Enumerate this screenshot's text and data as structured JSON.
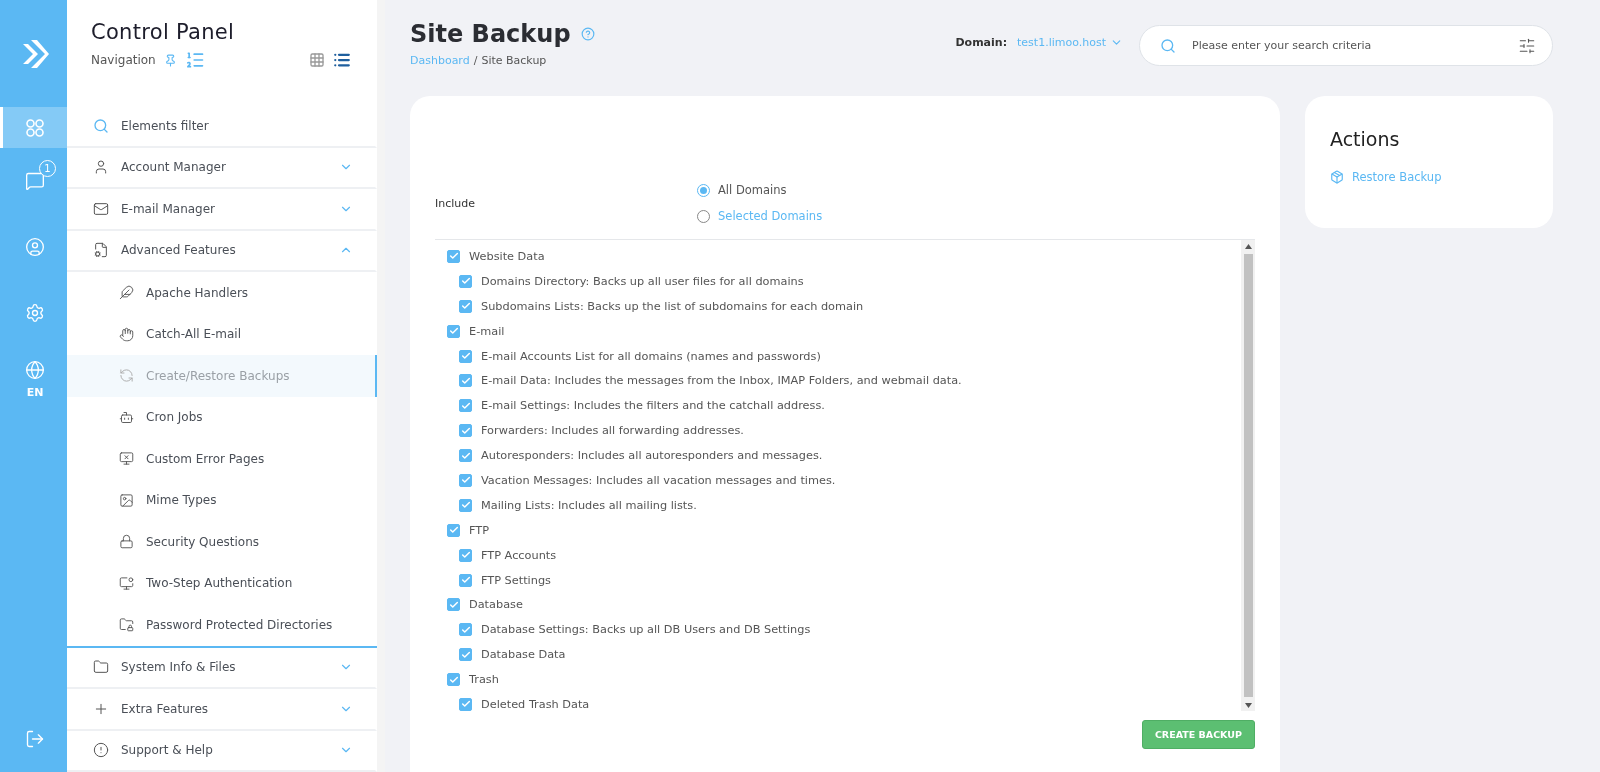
{
  "rail": {
    "language": "EN",
    "badge": "1",
    "items": [
      {
        "selected": false
      },
      {
        "selected": true
      },
      {
        "selected": false
      },
      {
        "selected": false
      },
      {
        "selected": false
      },
      {
        "selected": false
      }
    ]
  },
  "sidebar": {
    "title": "Control Panel",
    "subtitle": "Navigation",
    "filter": {
      "placeholder": "Elements filter"
    },
    "sections": [
      {
        "label": "Account Manager",
        "expanded": false
      },
      {
        "label": "E-mail Manager",
        "expanded": false
      },
      {
        "label": "Advanced Features",
        "expanded": true,
        "children": [
          {
            "label": "Apache Handlers",
            "selected": false
          },
          {
            "label": "Catch-All E-mail",
            "selected": false
          },
          {
            "label": "Create/Restore Backups",
            "selected": true
          },
          {
            "label": "Cron Jobs",
            "selected": false
          },
          {
            "label": "Custom Error Pages",
            "selected": false
          },
          {
            "label": "Mime Types",
            "selected": false
          },
          {
            "label": "Security Questions",
            "selected": false
          },
          {
            "label": "Two-Step Authentication",
            "selected": false
          },
          {
            "label": "Password Protected Directories",
            "selected": false
          }
        ]
      },
      {
        "label": "System Info & Files",
        "expanded": false
      },
      {
        "label": "Extra Features",
        "expanded": false
      },
      {
        "label": "Support & Help",
        "expanded": false
      }
    ]
  },
  "header": {
    "title": "Site Backup",
    "breadcrumb_separator": "/",
    "breadcrumb": [
      {
        "label": "Dashboard",
        "kind": "link"
      },
      {
        "label": "Site Backup",
        "kind": "current"
      }
    ],
    "domain_label": "Domain:",
    "domain": "test1.limoo.host",
    "search": {
      "placeholder": "Please enter your search criteria"
    }
  },
  "backup": {
    "include_label": "Include",
    "scope": [
      {
        "label": "All Domains",
        "selected": true
      },
      {
        "label": "Selected Domains",
        "selected": false
      }
    ],
    "groups": [
      {
        "label": "Website Data",
        "checked": true,
        "children": [
          {
            "label": "Domains Directory: Backs up all user files for all domains",
            "checked": true
          },
          {
            "label": "Subdomains Lists: Backs up the list of subdomains for each domain",
            "checked": true
          }
        ]
      },
      {
        "label": "E-mail",
        "checked": true,
        "children": [
          {
            "label": "E-mail Accounts List for all domains (names and passwords)",
            "checked": true
          },
          {
            "label": "E-mail Data: Includes the messages from the Inbox, IMAP Folders, and webmail data.",
            "checked": true
          },
          {
            "label": "E-mail Settings: Includes the filters and the catchall address.",
            "checked": true
          },
          {
            "label": "Forwarders: Includes all forwarding addresses.",
            "checked": true
          },
          {
            "label": "Autoresponders: Includes all autoresponders and messages.",
            "checked": true
          },
          {
            "label": "Vacation Messages: Includes all vacation messages and times.",
            "checked": true
          },
          {
            "label": "Mailing Lists: Includes all mailing lists.",
            "checked": true
          }
        ]
      },
      {
        "label": "FTP",
        "checked": true,
        "children": [
          {
            "label": "FTP Accounts",
            "checked": true
          },
          {
            "label": "FTP Settings",
            "checked": true
          }
        ]
      },
      {
        "label": "Database",
        "checked": true,
        "children": [
          {
            "label": "Database Settings: Backs up all DB Users and DB Settings",
            "checked": true
          },
          {
            "label": "Database Data",
            "checked": true
          }
        ]
      },
      {
        "label": "Trash",
        "checked": true,
        "children": [
          {
            "label": "Deleted Trash Data",
            "checked": true
          }
        ]
      }
    ],
    "button": "CREATE BACKUP"
  },
  "actions": {
    "title": "Actions",
    "items": [
      "Restore Backup"
    ]
  }
}
